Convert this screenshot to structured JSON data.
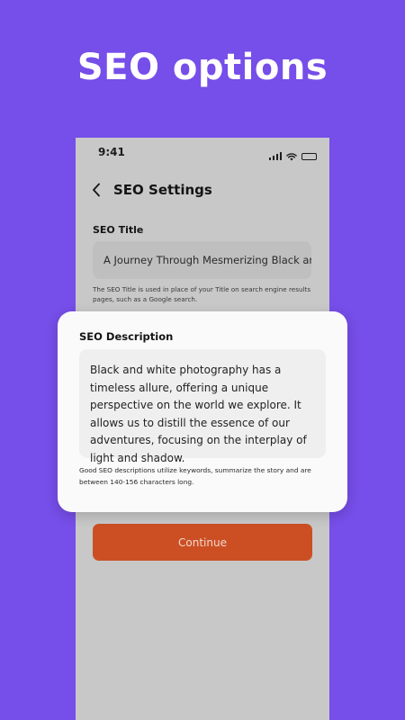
{
  "headline": "SEO options",
  "status_bar": {
    "time": "9:41",
    "icons": [
      "cellular-signal-icon",
      "wifi-icon",
      "battery-icon"
    ]
  },
  "nav": {
    "back_icon": "chevron-left-icon",
    "title": "SEO Settings"
  },
  "seo_title": {
    "label": "SEO Title",
    "value": "A Journey Through Mesmerizing Black and",
    "help": "The SEO Title is used in place of your Title on search engine results pages, such as a Google search."
  },
  "seo_description": {
    "label": "SEO Description",
    "value": "Black and white photography has a timeless allure, offering a unique perspective on the world we explore. It allows us to distill the essence of our adventures, focusing on the interplay of light and shadow.",
    "help": "Good SEO descriptions utilize keywords, summarize the story and are between 140-156 characters long."
  },
  "continue_button": {
    "label": "Continue"
  },
  "colors": {
    "background": "#764ee9",
    "phone_overlay": "#c8c8c8",
    "button": "#cc4f24",
    "card": "#fafafa"
  }
}
